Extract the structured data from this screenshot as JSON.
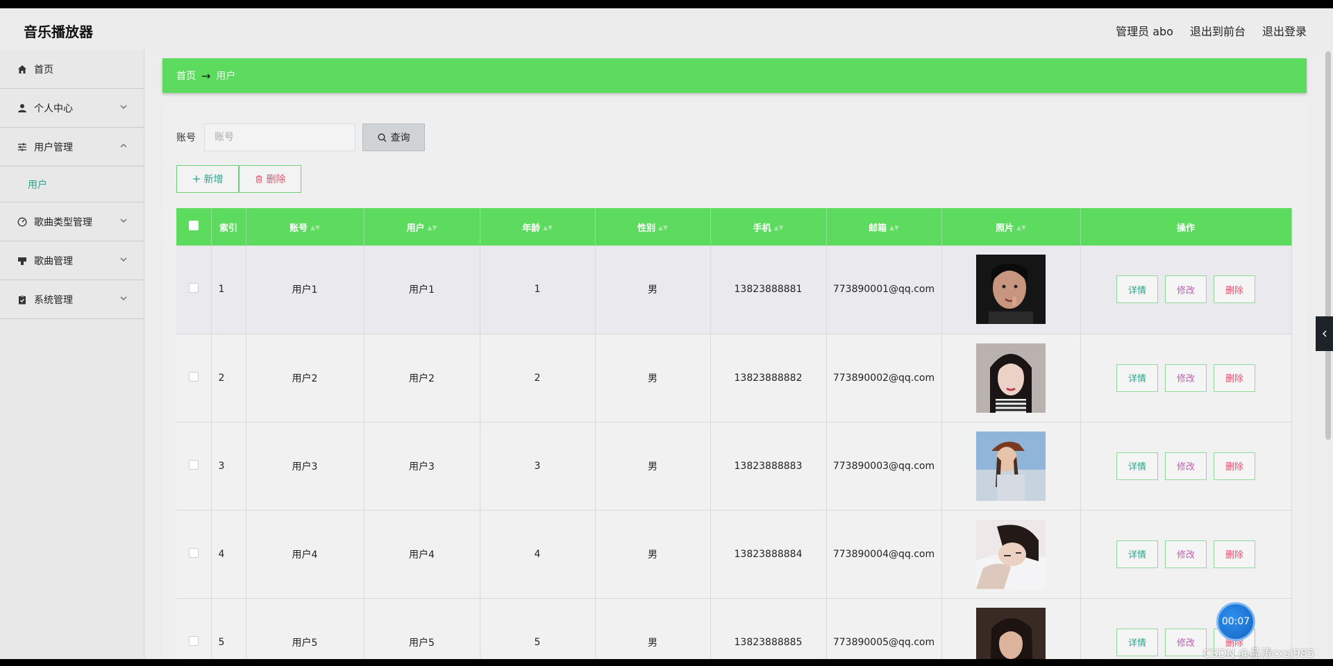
{
  "app": {
    "title": "音乐播放器"
  },
  "header": {
    "admin": "管理员 abo",
    "to_front": "退出到前台",
    "logout": "退出登录"
  },
  "sidebar": {
    "items": [
      {
        "label": "首页",
        "icon": "home-icon"
      },
      {
        "label": "个人中心",
        "icon": "user-icon"
      },
      {
        "label": "用户管理",
        "icon": "sliders-icon"
      },
      {
        "label": "用户",
        "icon": ""
      },
      {
        "label": "歌曲类型管理",
        "icon": "dashboard-icon"
      },
      {
        "label": "歌曲管理",
        "icon": "stamp-icon"
      },
      {
        "label": "系统管理",
        "icon": "clipboard-icon"
      }
    ]
  },
  "breadcrumb": {
    "home": "首页",
    "arrow": "→",
    "current": "用户"
  },
  "search": {
    "label": "账号",
    "placeholder": "账号",
    "button": "查询"
  },
  "actions": {
    "add": "新增",
    "delete": "删除"
  },
  "table": {
    "headers": [
      "索引",
      "账号",
      "用户",
      "年龄",
      "性别",
      "手机",
      "邮箱",
      "照片",
      "操作"
    ],
    "rows": [
      {
        "index": "1",
        "account": "用户1",
        "user": "用户1",
        "age": "1",
        "gender": "男",
        "phone": "13823888881",
        "email": "773890001@qq.com"
      },
      {
        "index": "2",
        "account": "用户2",
        "user": "用户2",
        "age": "2",
        "gender": "男",
        "phone": "13823888882",
        "email": "773890002@qq.com"
      },
      {
        "index": "3",
        "account": "用户3",
        "user": "用户3",
        "age": "3",
        "gender": "男",
        "phone": "13823888883",
        "email": "773890003@qq.com"
      },
      {
        "index": "4",
        "account": "用户4",
        "user": "用户4",
        "age": "4",
        "gender": "男",
        "phone": "13823888884",
        "email": "773890004@qq.com"
      },
      {
        "index": "5",
        "account": "用户5",
        "user": "用户5",
        "age": "5",
        "gender": "男",
        "phone": "13823888885",
        "email": "773890005@qq.com"
      }
    ],
    "ops": {
      "detail": "详情",
      "edit": "修改",
      "delete": "删除"
    }
  },
  "overlay": {
    "timer": "00:07",
    "watermark": "CSDN @晶涛cxsj985"
  },
  "colors": {
    "accent_green": "#5cdb5f",
    "teal_text": "#2aa58c",
    "pink_text": "#c15bb1",
    "red_text": "#e0566e"
  }
}
